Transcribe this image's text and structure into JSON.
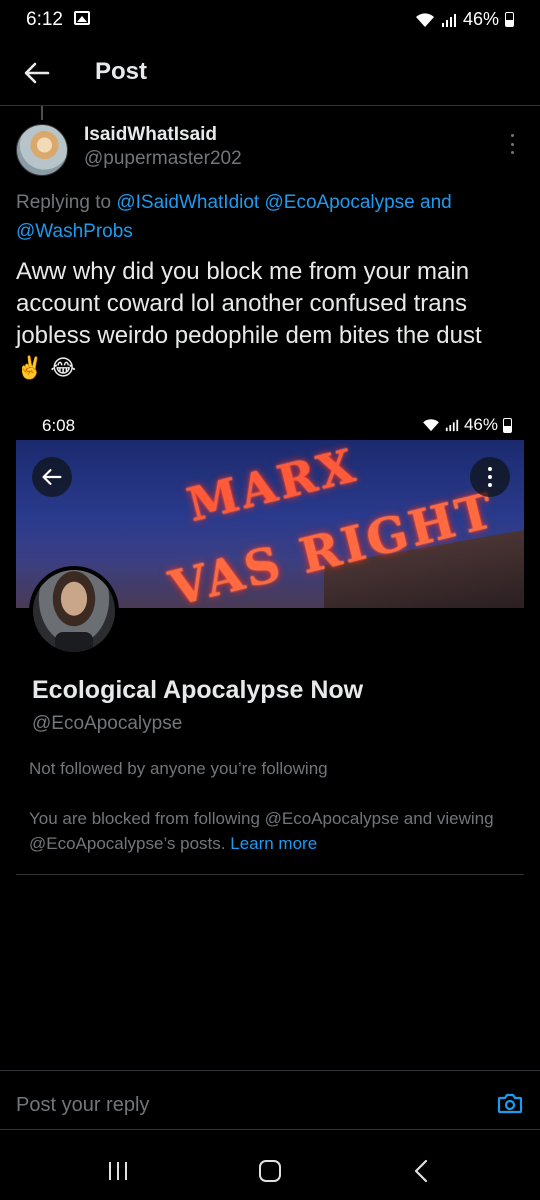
{
  "status_bar": {
    "time": "6:12",
    "battery": "46%"
  },
  "header": {
    "title": "Post"
  },
  "tweet": {
    "display_name": "IsaidWhatIsaid",
    "handle": "@pupermaster202",
    "replying_prefix": "Replying to",
    "mention_1": "@ISaidWhatIdiot",
    "mention_2": "@EcoApocalypse",
    "and_text": "and",
    "mention_3": "@WashProbs",
    "text": "Aww why did you block me from your main account coward lol another  confused trans jobless weirdo  pedophile dem bites the dust",
    "emojis": "✌️ 😂"
  },
  "embedded_screenshot": {
    "time": "6:08",
    "battery": "46%",
    "banner_line1": "MARX",
    "banner_line2": "VAS RIGHT",
    "profile_name": "Ecological Apocalypse Now",
    "profile_handle": "@EcoApocalypse",
    "not_followed": "Not followed by anyone you’re following",
    "blocked_text": "You are blocked from following @EcoApocalypse and viewing @EcoApocalypse’s posts.",
    "learn_more": "Learn more"
  },
  "reply": {
    "placeholder": "Post your reply"
  },
  "colors": {
    "accent": "#1d9bf0",
    "muted": "#71767b",
    "text": "#e7e9ea",
    "background": "#000000"
  }
}
